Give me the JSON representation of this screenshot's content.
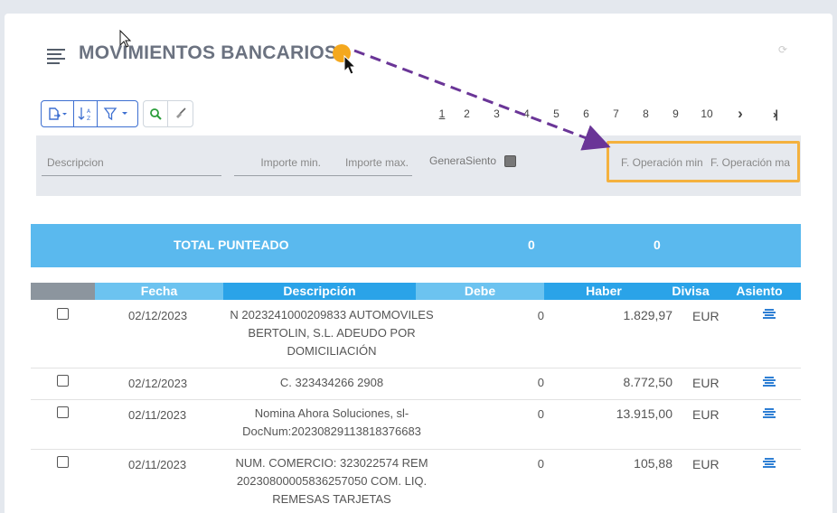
{
  "header": {
    "title": "MOVIMIENTOS BANCARIOS"
  },
  "pager": {
    "pages": [
      "1",
      "2",
      "3",
      "4",
      "5",
      "6",
      "7",
      "8",
      "9",
      "10"
    ],
    "current": "1",
    "next": "›",
    "last": "›|"
  },
  "filters": {
    "descripcion_placeholder": "Descripcion",
    "importe_min_placeholder": "Importe min.",
    "importe_max_placeholder": "Importe max.",
    "genera_siento_label": "GeneraSiento",
    "f_operacion_min_placeholder": "F. Operación min",
    "f_operacion_max_placeholder": "F. Operación max"
  },
  "totals": {
    "label": "TOTAL PUNTEADO",
    "debe": "0",
    "haber": "0"
  },
  "table": {
    "headers": {
      "fecha": "Fecha",
      "descripcion": "Descripción",
      "debe": "Debe",
      "haber": "Haber",
      "divisa": "Divisa",
      "asiento": "Asiento"
    },
    "rows": [
      {
        "fecha": "02/12/2023",
        "descripcion": "N 2023241000209833 AUTOMOVILES BERTOLIN, S.L. ADEUDO POR DOMICILIACIÓN",
        "debe": "0",
        "haber": "1.829,97",
        "divisa": "EUR"
      },
      {
        "fecha": "02/12/2023",
        "descripcion": "C. 323434266 2908",
        "debe": "0",
        "haber": "8.772,50",
        "divisa": "EUR"
      },
      {
        "fecha": "02/11/2023",
        "descripcion": "Nomina Ahora Soluciones, sl-DocNum:20230829113818376683",
        "debe": "0",
        "haber": "13.915,00",
        "divisa": "EUR"
      },
      {
        "fecha": "02/11/2023",
        "descripcion": "NUM. COMERCIO: 323022574 REM 20230800005836257050 COM. LIQ. REMESAS TARJETAS",
        "debe": "0",
        "haber": "105,88",
        "divisa": "EUR"
      }
    ]
  },
  "colors": {
    "accent": "#5ab9ee",
    "header_dark": "#2aa3e8",
    "header_light": "#6cc3f0",
    "highlight": "#f4b13e",
    "arrow": "#6a3597"
  }
}
